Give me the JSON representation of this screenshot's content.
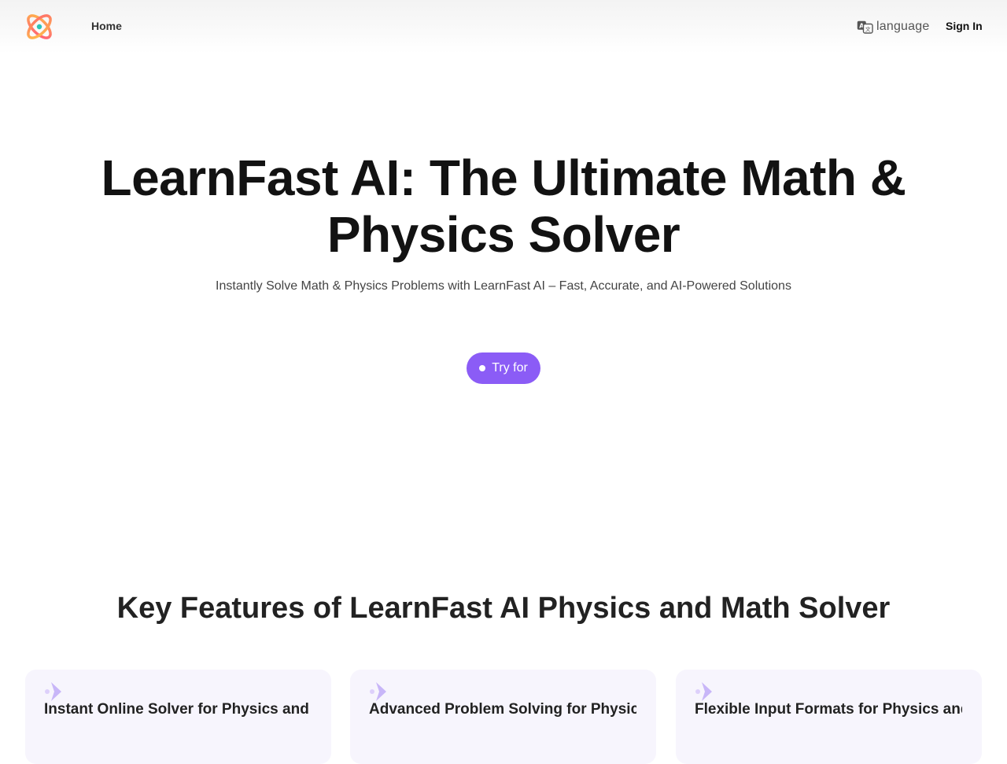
{
  "header": {
    "nav_home": "Home",
    "language_label": "language",
    "sign_in": "Sign In"
  },
  "hero": {
    "title": "LearnFast AI: The Ultimate Math & Physics Solver",
    "subtitle": "Instantly Solve Math & Physics Problems with LearnFast AI – Fast, Accurate, and AI-Powered Solutions",
    "cta_label": "Try for"
  },
  "features": {
    "title": "Key Features of LearnFast AI Physics and Math Solver",
    "cards": [
      {
        "title": "Instant Online Solver for Physics and Math"
      },
      {
        "title": "Advanced Problem Solving for Physics"
      },
      {
        "title": "Flexible Input Formats for Physics and Math"
      }
    ]
  },
  "colors": {
    "accent": "#8b5cf6",
    "card_bg": "#f7f5fd",
    "feature_icon": "#c8b6f8"
  },
  "icons": {
    "logo": "atom-logo-icon",
    "language": "translate-icon",
    "cta": "dot-icon",
    "feature": "sparkle-chevron-icon"
  }
}
